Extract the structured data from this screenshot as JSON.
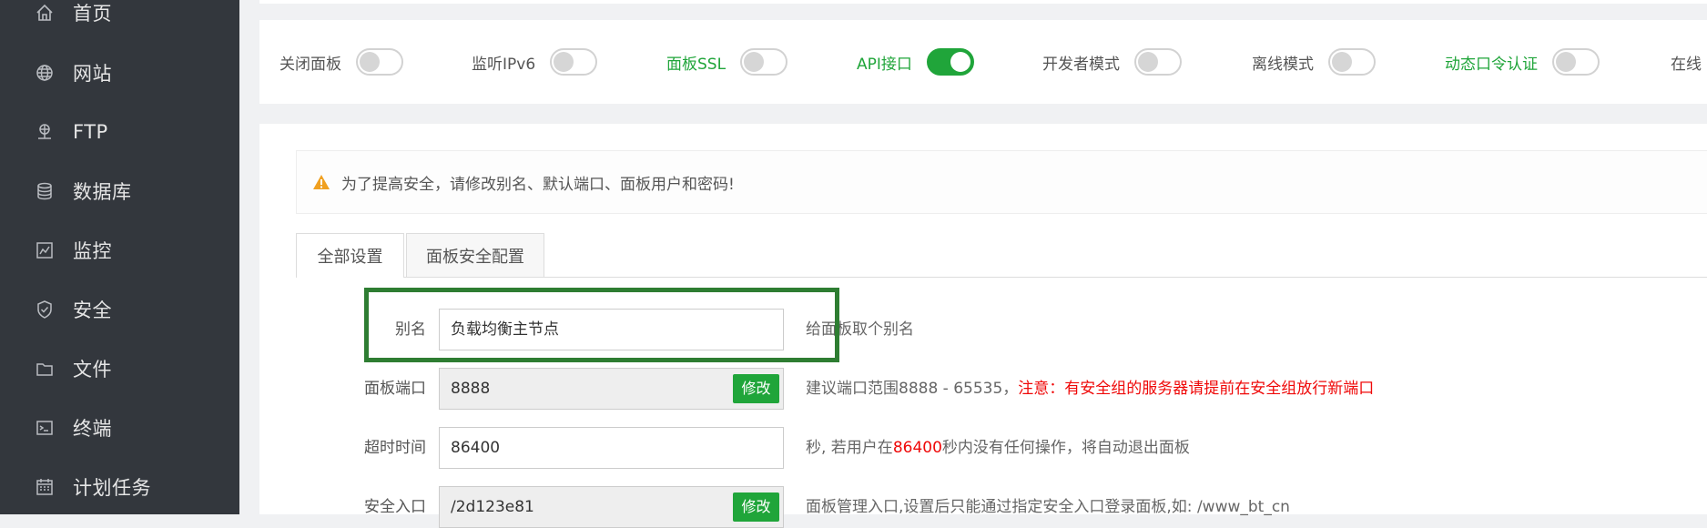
{
  "sidebar": {
    "items": [
      {
        "label": "首页",
        "icon": "home-icon"
      },
      {
        "label": "网站",
        "icon": "globe-icon"
      },
      {
        "label": "FTP",
        "icon": "ftp-icon"
      },
      {
        "label": "数据库",
        "icon": "database-icon"
      },
      {
        "label": "监控",
        "icon": "monitor-icon"
      },
      {
        "label": "安全",
        "icon": "shield-icon"
      },
      {
        "label": "文件",
        "icon": "folder-icon"
      },
      {
        "label": "终端",
        "icon": "terminal-icon"
      },
      {
        "label": "计划任务",
        "icon": "calendar-icon"
      }
    ]
  },
  "toggles": [
    {
      "label": "关闭面板",
      "on": false,
      "accent": false
    },
    {
      "label": "监听IPv6",
      "on": false,
      "accent": false
    },
    {
      "label": "面板SSL",
      "on": false,
      "accent": true
    },
    {
      "label": "API接口",
      "on": true,
      "accent": true
    },
    {
      "label": "开发者模式",
      "on": false,
      "accent": false
    },
    {
      "label": "离线模式",
      "on": false,
      "accent": false
    },
    {
      "label": "动态口令认证",
      "on": false,
      "accent": true
    },
    {
      "label": "在线",
      "on": false,
      "accent": false
    }
  ],
  "alert": {
    "text": "为了提高安全，请修改别名、默认端口、面板用户和密码!"
  },
  "tabs": [
    {
      "label": "全部设置",
      "active": true
    },
    {
      "label": "面板安全配置",
      "active": false
    }
  ],
  "form": {
    "alias": {
      "label": "别名",
      "value": "负载均衡主节点",
      "desc": "给面板取个别名"
    },
    "port": {
      "label": "面板端口",
      "value": "8888",
      "button": "修改",
      "desc_prefix": "建议端口范围8888 - 65535，",
      "desc_warning": "注意：有安全组的服务器请提前在安全组放行新端口"
    },
    "timeout": {
      "label": "超时时间",
      "value": "86400",
      "desc_prefix": "秒, 若用户在",
      "desc_value": "86400",
      "desc_suffix": "秒内没有任何操作，将自动退出面板"
    },
    "entry": {
      "label": "安全入口",
      "value": "/2d123e81",
      "button": "修改",
      "desc": "面板管理入口,设置后只能通过指定安全入口登录面板,如: /www_bt_cn"
    }
  },
  "colors": {
    "accent": "#20a53a",
    "sidebar_bg": "#33373d",
    "warning_text": "#ef0808",
    "highlight_border": "#2e7d32"
  }
}
